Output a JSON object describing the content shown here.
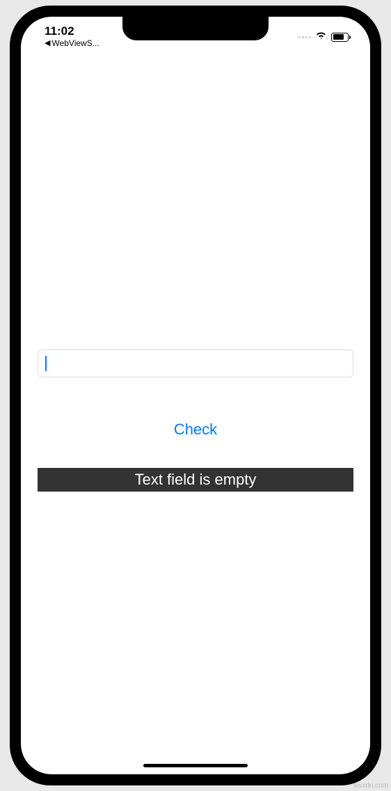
{
  "statusBar": {
    "time": "11:02",
    "backApp": "WebViewS..."
  },
  "input": {
    "value": ""
  },
  "button": {
    "check": "Check"
  },
  "result": {
    "message": "Text field is empty"
  },
  "watermark": "wsxdn.com"
}
